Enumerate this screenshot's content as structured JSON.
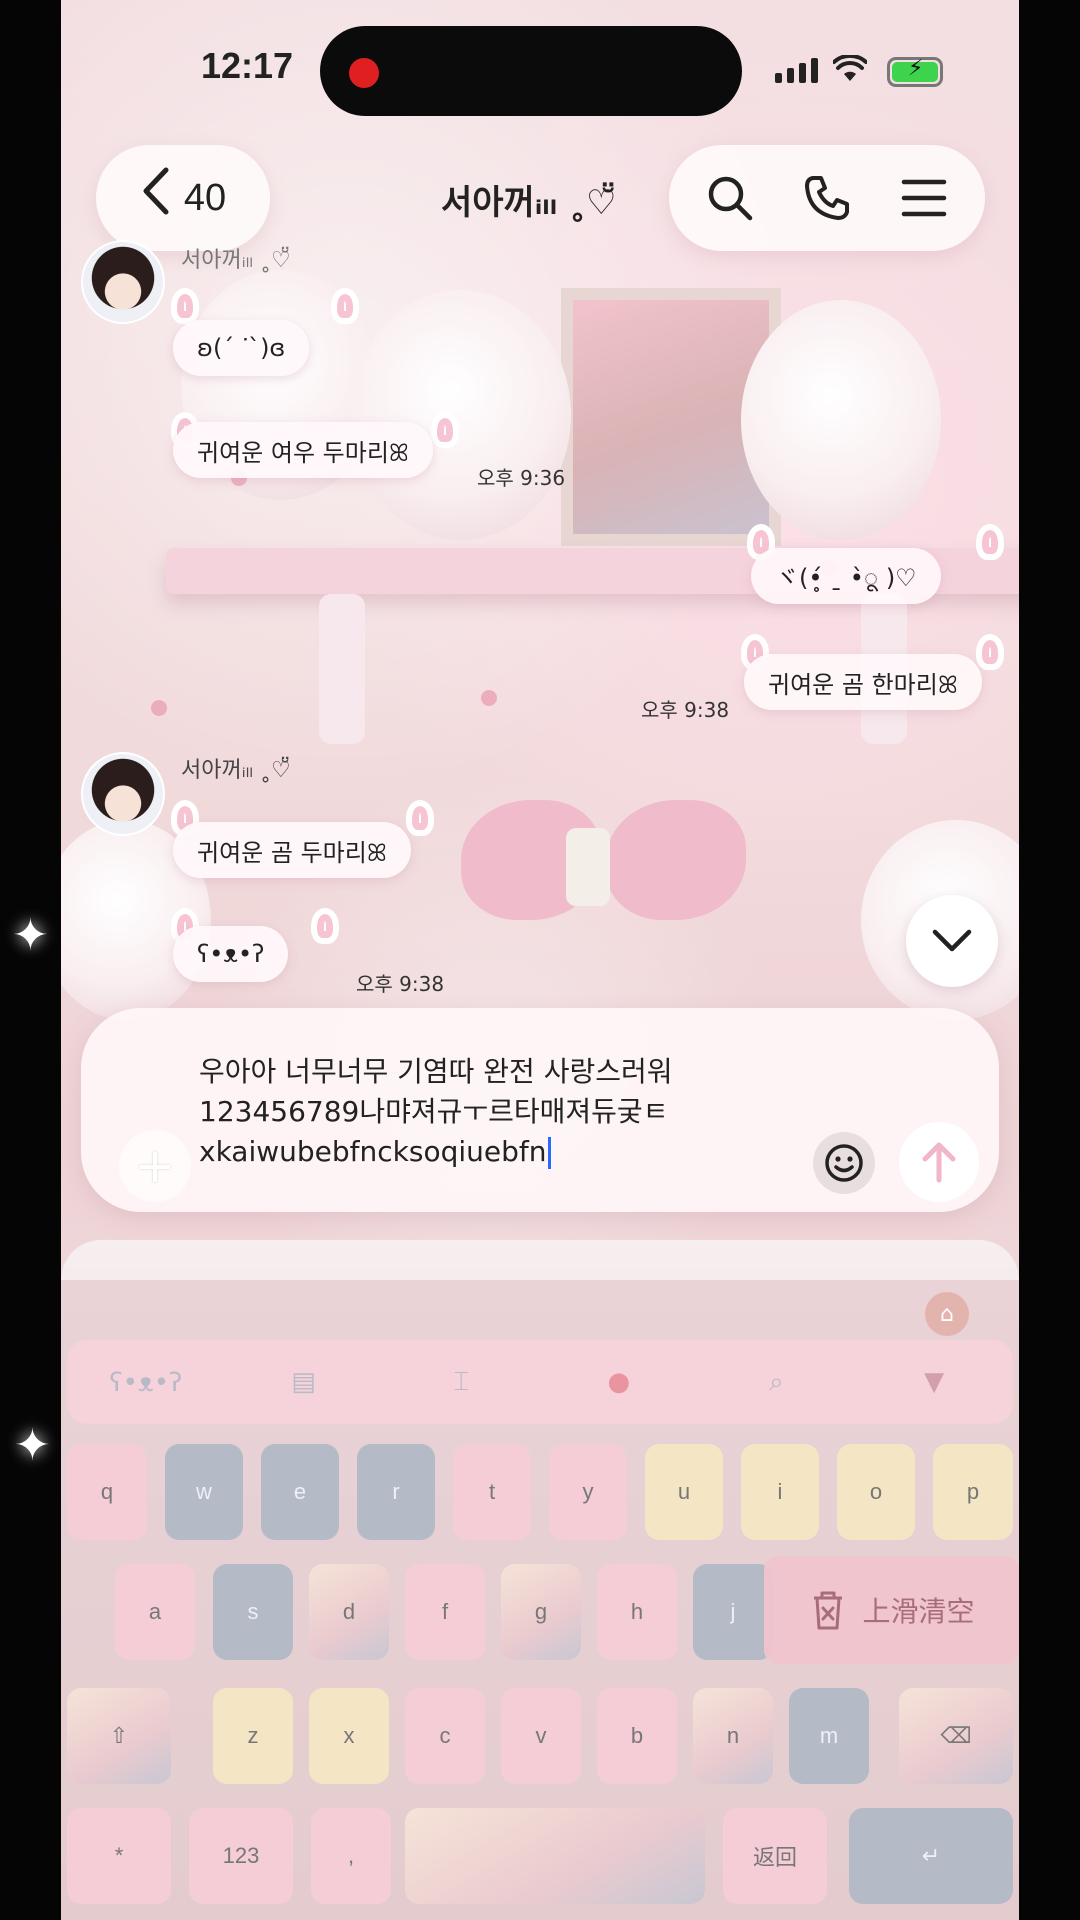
{
  "status_bar": {
    "time": "12:17"
  },
  "header": {
    "back_count": "40",
    "title": "서아꺼ᵢₗₗ ˳♡̆̈"
  },
  "icons": {
    "back": "chevron-left-icon",
    "search": "search-icon",
    "call": "phone-icon",
    "menu": "menu-icon",
    "scroll_down": "chevron-down-icon",
    "attach": "plus-icon",
    "emoji": "smiley-icon",
    "send": "arrow-up-icon"
  },
  "messages": [
    {
      "side": "left",
      "sender": "서아꺼ᵢₗₗ ˳♡̆̈",
      "text": "ʚ(ˊ ᐝˋ)ɞ",
      "time": ""
    },
    {
      "side": "left",
      "sender": "",
      "text": "귀여운 여우 두마리ꕤ",
      "time": "오후 9:36"
    },
    {
      "side": "right",
      "sender": "",
      "text": "ヾ(•̥́ ˍ •̀ू )♡",
      "time": ""
    },
    {
      "side": "right",
      "sender": "",
      "text": "귀여운 곰 한마리ꕤ",
      "time": "오후 9:38"
    },
    {
      "side": "left",
      "sender": "서아꺼ᵢₗₗ ˳♡̆̈",
      "text": "귀여운 곰 두마리ꕤ",
      "time": ""
    },
    {
      "side": "left",
      "sender": "",
      "text": "ʕ•ᴥ•ʔ",
      "time": "오후 9:38"
    }
  ],
  "compose": {
    "lines": [
      "우아아 너무너무 기염따 완전 사랑스러워",
      "123456789나먀져규ㅜ르타매져듀궂ㅌ",
      "xkaiwubebfncksoqiuebfn"
    ]
  },
  "keyboard": {
    "row1": [
      "q",
      "w",
      "e",
      "r",
      "t",
      "y",
      "u",
      "i",
      "o",
      "p"
    ],
    "row2": [
      "a",
      "s",
      "d",
      "f",
      "g",
      "h",
      "j"
    ],
    "row3": [
      "z",
      "x",
      "c",
      "v",
      "b",
      "n",
      "m"
    ],
    "bottom": {
      "symbols": "*",
      "numbers": "123",
      "punct": ",",
      "return": "返回"
    },
    "clear_hint": "上滑清空",
    "toolbar_icons": [
      "bear-icon",
      "clipboard-icon",
      "cursor-icon",
      "sticker-icon",
      "search-icon",
      "collapse-icon"
    ]
  }
}
